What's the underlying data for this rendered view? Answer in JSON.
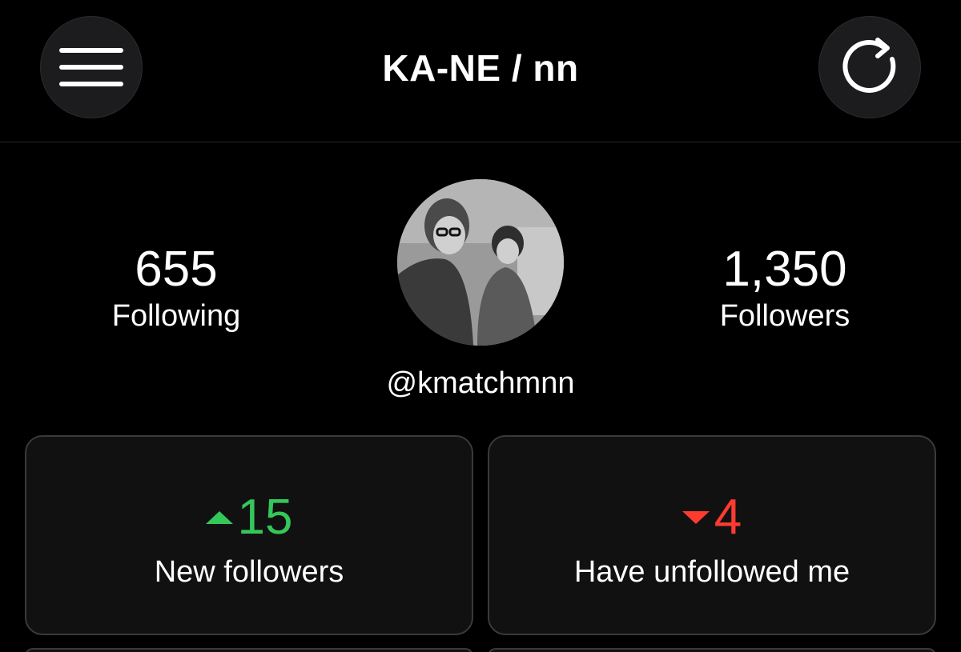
{
  "header": {
    "title": "KA-NE / nn",
    "menu_icon": "hamburger-menu-icon",
    "refresh_icon": "refresh-icon"
  },
  "profile": {
    "following_count": "655",
    "following_label": "Following",
    "followers_count": "1,350",
    "followers_label": "Followers",
    "handle": "@kmatchmnn"
  },
  "cards": {
    "new_followers": {
      "value": "15",
      "label": "New followers",
      "trend_icon": "triangle-up-icon",
      "color": "#34c759"
    },
    "unfollowed": {
      "value": "4",
      "label": "Have unfollowed me",
      "trend_icon": "triangle-down-icon",
      "color": "#ff3b30"
    }
  },
  "colors": {
    "background": "#000000",
    "card_background": "#111112",
    "card_border": "#3a3a3c",
    "button_background": "#1c1c1e",
    "positive": "#34c759",
    "negative": "#ff3b30"
  }
}
